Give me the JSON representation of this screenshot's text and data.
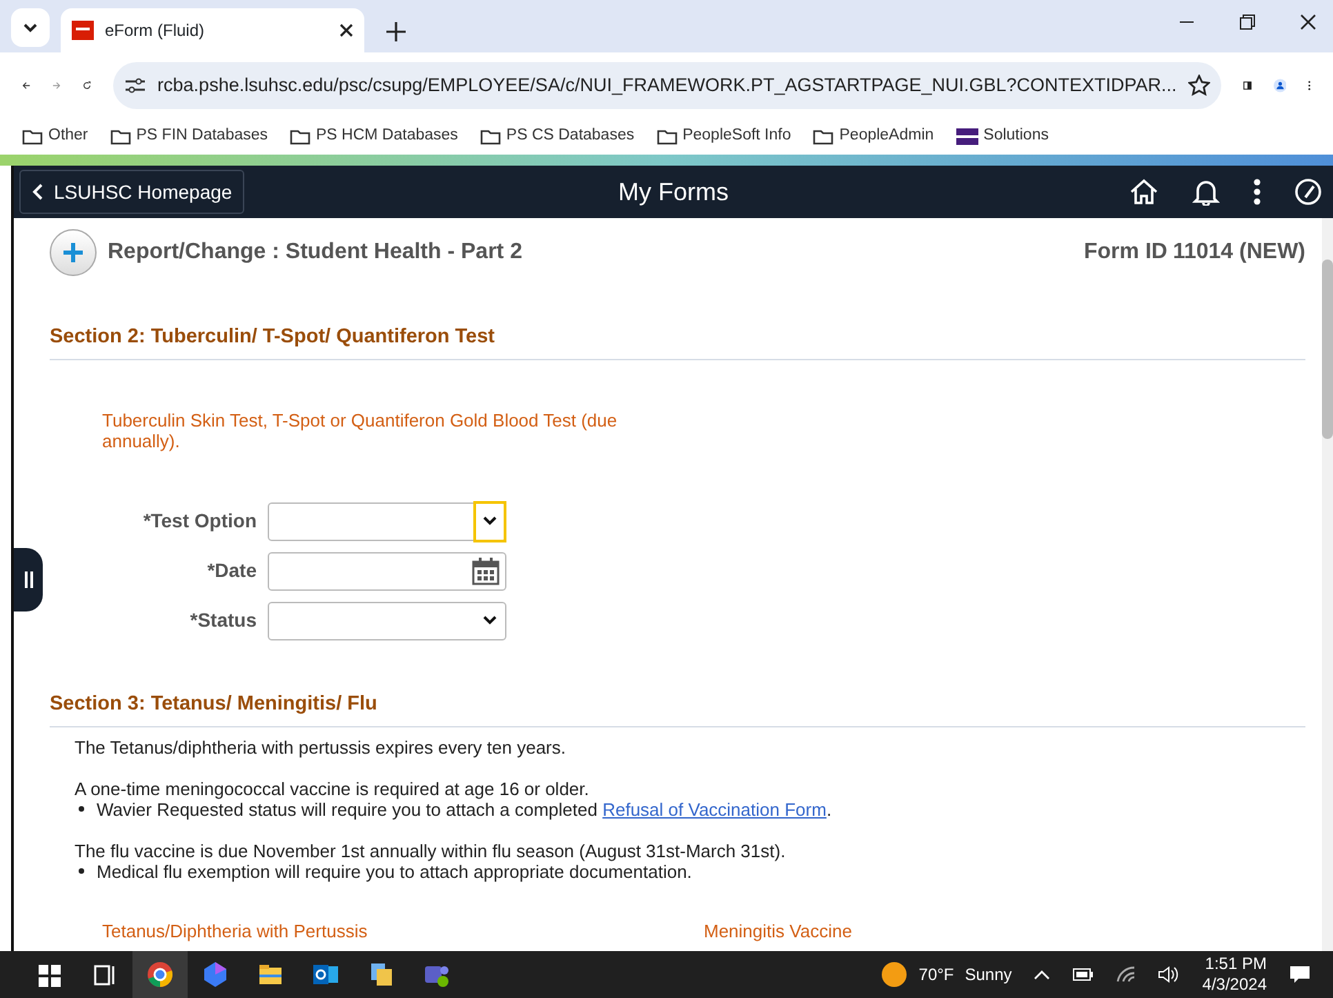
{
  "browser": {
    "tabs": [
      {
        "title": "eForm (Fluid)",
        "selected": true
      }
    ],
    "address": "rcba.pshe.lsuhsc.edu/psc/csupg/EMPLOYEE/SA/c/NUI_FRAMEWORK.PT_AGSTARTPAGE_NUI.GBL?CONTEXTIDPAR...",
    "bookmarks": [
      {
        "label": "Other",
        "kind": "folder"
      },
      {
        "label": "PS FIN Databases",
        "kind": "folder"
      },
      {
        "label": "PS HCM Databases",
        "kind": "folder"
      },
      {
        "label": "PS CS Databases",
        "kind": "folder"
      },
      {
        "label": "PeopleSoft Info",
        "kind": "folder"
      },
      {
        "label": "PeopleAdmin",
        "kind": "folder"
      },
      {
        "label": "Solutions",
        "kind": "logo"
      }
    ]
  },
  "app_header": {
    "back_button": "LSUHSC Homepage",
    "title": "My Forms"
  },
  "form": {
    "heading": "Report/Change :  Student Health - Part 2",
    "form_id_label": "Form ID",
    "form_id": "11014 (NEW)"
  },
  "section_2": {
    "title": "Section 2: Tuberculin/ T-Spot/ Quantiferon Test",
    "note": "Tuberculin Skin Test, T-Spot or Quantiferon Gold Blood Test (due annually).",
    "fields": [
      {
        "label": "*Test Option",
        "kind": "select",
        "focused": true
      },
      {
        "label": "*Date",
        "kind": "date",
        "focused": false
      },
      {
        "label": "*Status",
        "kind": "select",
        "focused": false
      }
    ]
  },
  "section_3": {
    "title": "Section 3: Tetanus/ Meningitis/ Flu",
    "paragraphs": [
      {
        "text": "The Tetanus/diphtheria with pertussis expires every ten years."
      },
      {
        "text": "A one-time meningococcal vaccine is required at age 16 or older.",
        "bullets": [
          {
            "text": "Wavier Requested status will require you to attach a completed ",
            "link": "Refusal of Vaccination Form",
            "after": "."
          }
        ]
      },
      {
        "text": "The flu vaccine is due November 1st annually within flu season (August 31st-March 31st).",
        "bullets": [
          {
            "text": "Medical flu exemption will require you to attach appropriate documentation."
          }
        ]
      }
    ],
    "columns": [
      "Tetanus/Diphtheria with Pertussis",
      "Meningitis Vaccine"
    ]
  },
  "taskbar": {
    "apps": [
      {
        "kind": "windows",
        "active": false
      },
      {
        "kind": "taskview",
        "active": false
      },
      {
        "kind": "chrome",
        "active": true
      },
      {
        "kind": "copilot",
        "active": false
      },
      {
        "kind": "explorer",
        "active": false
      },
      {
        "kind": "outlook",
        "active": false
      },
      {
        "kind": "files",
        "active": false
      },
      {
        "kind": "teams",
        "active": false
      }
    ],
    "temperature": "70°F",
    "weather": "Sunny",
    "time": "1:51 PM",
    "date": "4/3/2024"
  }
}
